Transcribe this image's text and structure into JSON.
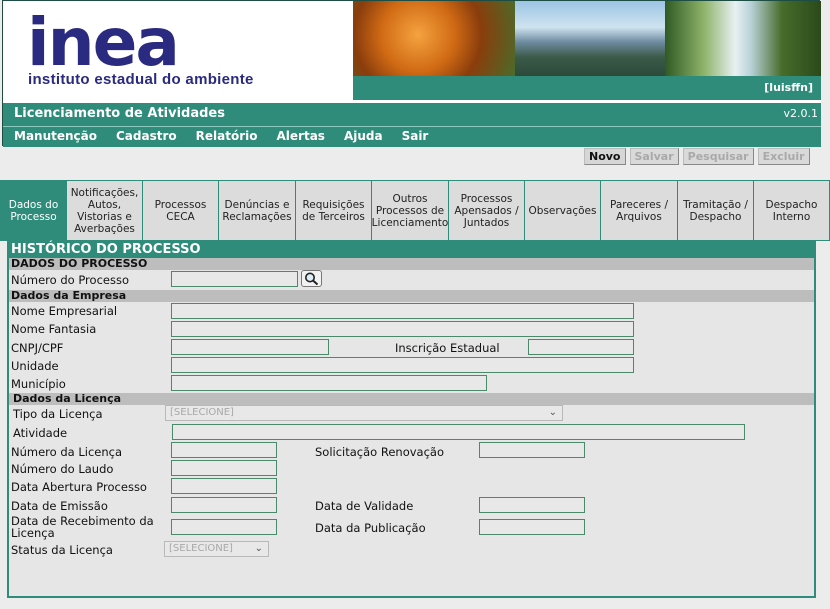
{
  "header": {
    "logo_word": "inea",
    "logo_subtitle": "instituto estadual do ambiente",
    "user": "[luisffn]",
    "app_title": "Licenciamento de Atividades",
    "version": "v2.0.1"
  },
  "menu": [
    "Manutenção",
    "Cadastro",
    "Relatório",
    "Alertas",
    "Ajuda",
    "Sair"
  ],
  "toolbar": {
    "novo": "Novo",
    "salvar": "Salvar",
    "pesquisar": "Pesquisar",
    "excluir": "Excluir"
  },
  "tabs": [
    "Dados do Processo",
    "Notificações, Autos, Vistorias e Averbações",
    "Processos CECA",
    "Denúncias e Reclamações",
    "Requisições de Terceiros",
    "Outros Processos de Licenciamento",
    "Processos Apensados / Juntados",
    "Observações",
    "Pareceres / Arquivos",
    "Tramitação / Despacho",
    "Despacho Interno"
  ],
  "form": {
    "title": "HISTÓRICO DO PROCESSO",
    "section_processo": "DADOS DO PROCESSO",
    "numero_processo": "Número do Processo",
    "section_empresa": "Dados da Empresa",
    "nome_empresarial": "Nome Empresarial",
    "nome_fantasia": "Nome Fantasia",
    "cnpj": "CNPJ/CPF",
    "inscricao": "Inscrição Estadual",
    "unidade": "Unidade",
    "municipio": "Município",
    "section_licenca": "Dados da Licença",
    "tipo_licenca": "Tipo da Licença",
    "select_placeholder": "[SELECIONE]",
    "atividade": "Atividade",
    "numero_licenca": "Número da Licença",
    "solicitacao_renovacao": "Solicitação Renovação",
    "numero_laudo": "Número do Laudo",
    "data_abertura": "Data Abertura Processo",
    "data_emissao": "Data de Emissão",
    "data_validade": "Data de Validade",
    "data_recebimento": "Data de Recebimento da Licença",
    "data_publicacao": "Data da Publicação",
    "status_licenca": "Status da Licença"
  }
}
